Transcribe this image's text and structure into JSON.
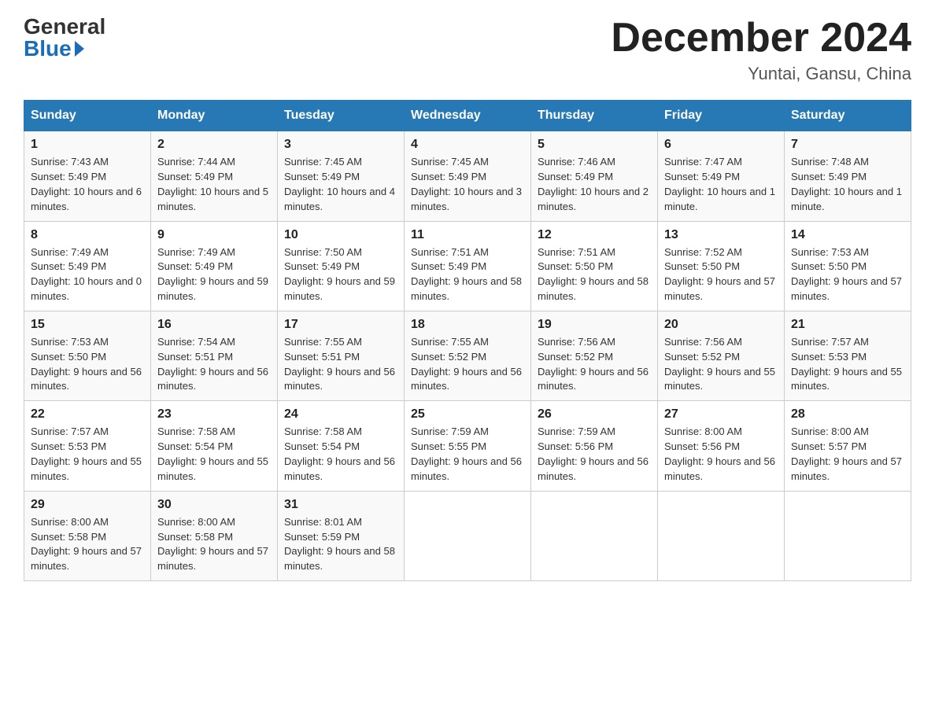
{
  "header": {
    "logo_general": "General",
    "logo_blue": "Blue",
    "month_title": "December 2024",
    "location": "Yuntai, Gansu, China"
  },
  "days_of_week": [
    "Sunday",
    "Monday",
    "Tuesday",
    "Wednesday",
    "Thursday",
    "Friday",
    "Saturday"
  ],
  "weeks": [
    [
      {
        "day": "1",
        "sunrise": "Sunrise: 7:43 AM",
        "sunset": "Sunset: 5:49 PM",
        "daylight": "Daylight: 10 hours and 6 minutes."
      },
      {
        "day": "2",
        "sunrise": "Sunrise: 7:44 AM",
        "sunset": "Sunset: 5:49 PM",
        "daylight": "Daylight: 10 hours and 5 minutes."
      },
      {
        "day": "3",
        "sunrise": "Sunrise: 7:45 AM",
        "sunset": "Sunset: 5:49 PM",
        "daylight": "Daylight: 10 hours and 4 minutes."
      },
      {
        "day": "4",
        "sunrise": "Sunrise: 7:45 AM",
        "sunset": "Sunset: 5:49 PM",
        "daylight": "Daylight: 10 hours and 3 minutes."
      },
      {
        "day": "5",
        "sunrise": "Sunrise: 7:46 AM",
        "sunset": "Sunset: 5:49 PM",
        "daylight": "Daylight: 10 hours and 2 minutes."
      },
      {
        "day": "6",
        "sunrise": "Sunrise: 7:47 AM",
        "sunset": "Sunset: 5:49 PM",
        "daylight": "Daylight: 10 hours and 1 minute."
      },
      {
        "day": "7",
        "sunrise": "Sunrise: 7:48 AM",
        "sunset": "Sunset: 5:49 PM",
        "daylight": "Daylight: 10 hours and 1 minute."
      }
    ],
    [
      {
        "day": "8",
        "sunrise": "Sunrise: 7:49 AM",
        "sunset": "Sunset: 5:49 PM",
        "daylight": "Daylight: 10 hours and 0 minutes."
      },
      {
        "day": "9",
        "sunrise": "Sunrise: 7:49 AM",
        "sunset": "Sunset: 5:49 PM",
        "daylight": "Daylight: 9 hours and 59 minutes."
      },
      {
        "day": "10",
        "sunrise": "Sunrise: 7:50 AM",
        "sunset": "Sunset: 5:49 PM",
        "daylight": "Daylight: 9 hours and 59 minutes."
      },
      {
        "day": "11",
        "sunrise": "Sunrise: 7:51 AM",
        "sunset": "Sunset: 5:49 PM",
        "daylight": "Daylight: 9 hours and 58 minutes."
      },
      {
        "day": "12",
        "sunrise": "Sunrise: 7:51 AM",
        "sunset": "Sunset: 5:50 PM",
        "daylight": "Daylight: 9 hours and 58 minutes."
      },
      {
        "day": "13",
        "sunrise": "Sunrise: 7:52 AM",
        "sunset": "Sunset: 5:50 PM",
        "daylight": "Daylight: 9 hours and 57 minutes."
      },
      {
        "day": "14",
        "sunrise": "Sunrise: 7:53 AM",
        "sunset": "Sunset: 5:50 PM",
        "daylight": "Daylight: 9 hours and 57 minutes."
      }
    ],
    [
      {
        "day": "15",
        "sunrise": "Sunrise: 7:53 AM",
        "sunset": "Sunset: 5:50 PM",
        "daylight": "Daylight: 9 hours and 56 minutes."
      },
      {
        "day": "16",
        "sunrise": "Sunrise: 7:54 AM",
        "sunset": "Sunset: 5:51 PM",
        "daylight": "Daylight: 9 hours and 56 minutes."
      },
      {
        "day": "17",
        "sunrise": "Sunrise: 7:55 AM",
        "sunset": "Sunset: 5:51 PM",
        "daylight": "Daylight: 9 hours and 56 minutes."
      },
      {
        "day": "18",
        "sunrise": "Sunrise: 7:55 AM",
        "sunset": "Sunset: 5:52 PM",
        "daylight": "Daylight: 9 hours and 56 minutes."
      },
      {
        "day": "19",
        "sunrise": "Sunrise: 7:56 AM",
        "sunset": "Sunset: 5:52 PM",
        "daylight": "Daylight: 9 hours and 56 minutes."
      },
      {
        "day": "20",
        "sunrise": "Sunrise: 7:56 AM",
        "sunset": "Sunset: 5:52 PM",
        "daylight": "Daylight: 9 hours and 55 minutes."
      },
      {
        "day": "21",
        "sunrise": "Sunrise: 7:57 AM",
        "sunset": "Sunset: 5:53 PM",
        "daylight": "Daylight: 9 hours and 55 minutes."
      }
    ],
    [
      {
        "day": "22",
        "sunrise": "Sunrise: 7:57 AM",
        "sunset": "Sunset: 5:53 PM",
        "daylight": "Daylight: 9 hours and 55 minutes."
      },
      {
        "day": "23",
        "sunrise": "Sunrise: 7:58 AM",
        "sunset": "Sunset: 5:54 PM",
        "daylight": "Daylight: 9 hours and 55 minutes."
      },
      {
        "day": "24",
        "sunrise": "Sunrise: 7:58 AM",
        "sunset": "Sunset: 5:54 PM",
        "daylight": "Daylight: 9 hours and 56 minutes."
      },
      {
        "day": "25",
        "sunrise": "Sunrise: 7:59 AM",
        "sunset": "Sunset: 5:55 PM",
        "daylight": "Daylight: 9 hours and 56 minutes."
      },
      {
        "day": "26",
        "sunrise": "Sunrise: 7:59 AM",
        "sunset": "Sunset: 5:56 PM",
        "daylight": "Daylight: 9 hours and 56 minutes."
      },
      {
        "day": "27",
        "sunrise": "Sunrise: 8:00 AM",
        "sunset": "Sunset: 5:56 PM",
        "daylight": "Daylight: 9 hours and 56 minutes."
      },
      {
        "day": "28",
        "sunrise": "Sunrise: 8:00 AM",
        "sunset": "Sunset: 5:57 PM",
        "daylight": "Daylight: 9 hours and 57 minutes."
      }
    ],
    [
      {
        "day": "29",
        "sunrise": "Sunrise: 8:00 AM",
        "sunset": "Sunset: 5:58 PM",
        "daylight": "Daylight: 9 hours and 57 minutes."
      },
      {
        "day": "30",
        "sunrise": "Sunrise: 8:00 AM",
        "sunset": "Sunset: 5:58 PM",
        "daylight": "Daylight: 9 hours and 57 minutes."
      },
      {
        "day": "31",
        "sunrise": "Sunrise: 8:01 AM",
        "sunset": "Sunset: 5:59 PM",
        "daylight": "Daylight: 9 hours and 58 minutes."
      },
      null,
      null,
      null,
      null
    ]
  ]
}
